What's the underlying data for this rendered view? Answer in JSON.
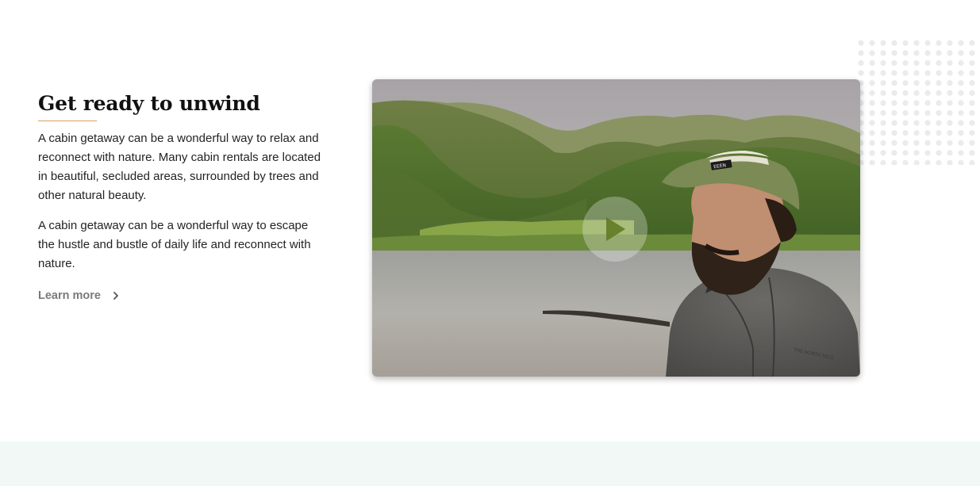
{
  "section": {
    "heading": "Get ready to unwind",
    "paragraphs": [
      "A cabin getaway can be a wonderful way to relax and reconnect with nature. Many cabin rentals are located in beautiful, secluded areas, surrounded by trees and other natural beauty.",
      "A cabin getaway can be a wonderful way to escape the hustle and bustle of daily life and reconnect with nature."
    ],
    "learn_more_label": "Learn more"
  },
  "video": {
    "play_icon": "play-icon",
    "cap_badge": "EEEN",
    "hoodie_logo": "THE NORTH FACE"
  },
  "colors": {
    "heading_underline": "#d9a15a",
    "link_gray": "#7a7a7a",
    "bottom_band": "#f1f8f6",
    "dot_pattern": "#ebebeb"
  }
}
